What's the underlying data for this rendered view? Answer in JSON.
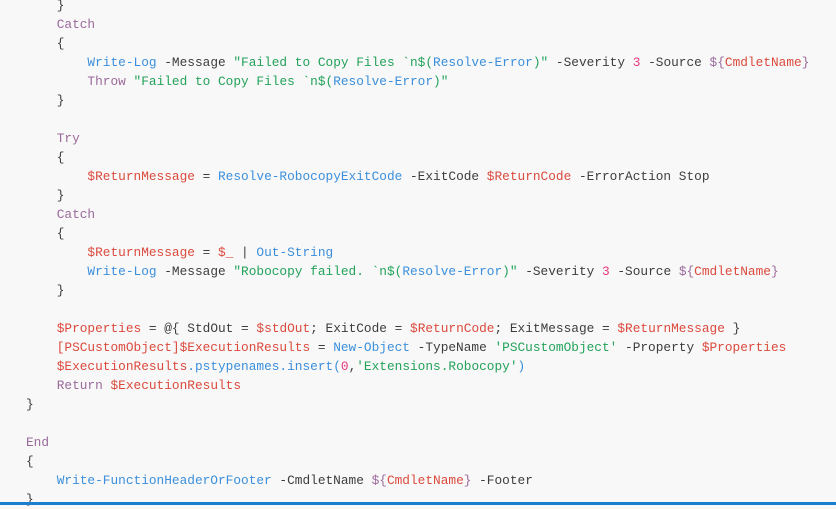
{
  "code_lines": [
    [
      [
        "p",
        "    }"
      ]
    ],
    [
      [
        "k",
        "    Catch"
      ]
    ],
    [
      [
        "p",
        "    {"
      ]
    ],
    [
      [
        "c",
        "        Write-Log"
      ],
      [
        "p",
        " -Message "
      ],
      [
        "s",
        "\"Failed to Copy Files `n$("
      ],
      [
        "c",
        "Resolve-Error"
      ],
      [
        "s",
        ")\""
      ],
      [
        "p",
        " -Severity "
      ],
      [
        "n",
        "3"
      ],
      [
        "p",
        " -Source "
      ],
      [
        "k",
        "${"
      ],
      [
        "v",
        "CmdletName"
      ],
      [
        "k",
        "}"
      ]
    ],
    [
      [
        "k",
        "        Throw"
      ],
      [
        "p",
        " "
      ],
      [
        "s",
        "\"Failed to Copy Files `n$("
      ],
      [
        "c",
        "Resolve-Error"
      ],
      [
        "s",
        ")\""
      ]
    ],
    [
      [
        "p",
        "    }"
      ]
    ],
    [
      [
        "p",
        ""
      ]
    ],
    [
      [
        "k",
        "    Try"
      ]
    ],
    [
      [
        "p",
        "    {"
      ]
    ],
    [
      [
        "v",
        "        $ReturnMessage"
      ],
      [
        "p",
        " = "
      ],
      [
        "c",
        "Resolve-RobocopyExitCode"
      ],
      [
        "p",
        " -ExitCode "
      ],
      [
        "v",
        "$ReturnCode"
      ],
      [
        "p",
        " -ErrorAction Stop"
      ]
    ],
    [
      [
        "p",
        "    }"
      ]
    ],
    [
      [
        "k",
        "    Catch"
      ]
    ],
    [
      [
        "p",
        "    {"
      ]
    ],
    [
      [
        "v",
        "        $ReturnMessage"
      ],
      [
        "p",
        " = "
      ],
      [
        "v",
        "$_"
      ],
      [
        "p",
        " | "
      ],
      [
        "c",
        "Out-String"
      ]
    ],
    [
      [
        "c",
        "        Write-Log"
      ],
      [
        "p",
        " -Message "
      ],
      [
        "s",
        "\"Robocopy failed. `n$("
      ],
      [
        "c",
        "Resolve-Error"
      ],
      [
        "s",
        ")\""
      ],
      [
        "p",
        " -Severity "
      ],
      [
        "n",
        "3"
      ],
      [
        "p",
        " -Source "
      ],
      [
        "k",
        "${"
      ],
      [
        "v",
        "CmdletName"
      ],
      [
        "k",
        "}"
      ]
    ],
    [
      [
        "p",
        "    }"
      ]
    ],
    [
      [
        "p",
        ""
      ]
    ],
    [
      [
        "v",
        "    $Properties"
      ],
      [
        "p",
        " = @{ StdOut = "
      ],
      [
        "v",
        "$stdOut"
      ],
      [
        "p",
        "; ExitCode = "
      ],
      [
        "v",
        "$ReturnCode"
      ],
      [
        "p",
        "; ExitMessage = "
      ],
      [
        "v",
        "$ReturnMessage"
      ],
      [
        "p",
        " }"
      ]
    ],
    [
      [
        "v",
        "    [PSCustomObject]$ExecutionResults"
      ],
      [
        "p",
        " = "
      ],
      [
        "c",
        "New-Object"
      ],
      [
        "p",
        " -TypeName "
      ],
      [
        "s",
        "'PSCustomObject'"
      ],
      [
        "p",
        " -Property "
      ],
      [
        "v",
        "$Properties"
      ]
    ],
    [
      [
        "v",
        "    $ExecutionResults"
      ],
      [
        "c",
        ".pstypenames.insert("
      ],
      [
        "n",
        "0"
      ],
      [
        "p",
        ","
      ],
      [
        "s",
        "'Extensions.Robocopy'"
      ],
      [
        "c",
        ")"
      ]
    ],
    [
      [
        "k",
        "    Return"
      ],
      [
        "p",
        " "
      ],
      [
        "v",
        "$ExecutionResults"
      ]
    ],
    [
      [
        "p",
        "}"
      ]
    ],
    [
      [
        "p",
        ""
      ]
    ],
    [
      [
        "k",
        "End"
      ]
    ],
    [
      [
        "p",
        "{"
      ]
    ],
    [
      [
        "c",
        "    Write-FunctionHeaderOrFooter"
      ],
      [
        "p",
        " -CmdletName "
      ],
      [
        "k",
        "${"
      ],
      [
        "v",
        "CmdletName"
      ],
      [
        "k",
        "}"
      ],
      [
        "p",
        " -Footer"
      ]
    ],
    [
      [
        "p",
        "}"
      ]
    ]
  ]
}
